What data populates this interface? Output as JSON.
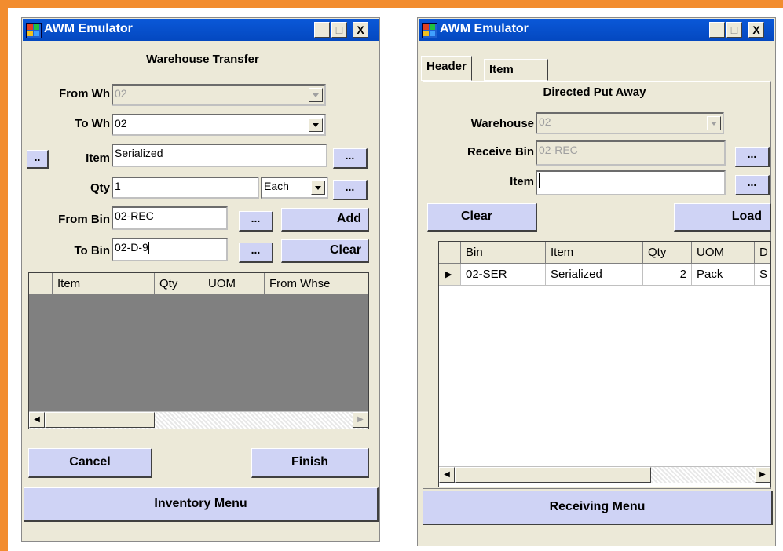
{
  "left_window": {
    "title": "AWM Emulator",
    "window_buttons": {
      "minimize": "_",
      "maximize": "□",
      "close": "X"
    },
    "form_title": "Warehouse Transfer",
    "from_wh": {
      "label": "From Wh",
      "value": "02"
    },
    "to_wh": {
      "label": "To Wh",
      "value": "02"
    },
    "item": {
      "small_button": "..",
      "label": "Item",
      "value": "Serialized",
      "lookup": "..."
    },
    "qty": {
      "label": "Qty",
      "value": "1",
      "uom": "Each",
      "lookup": "..."
    },
    "from_bin": {
      "label": "From Bin",
      "value": "02-REC",
      "lookup": "...",
      "action": "Add"
    },
    "to_bin": {
      "label": "To Bin",
      "value": "02-D-9",
      "lookup": "...",
      "action": "Clear"
    },
    "grid": {
      "columns": [
        "Item",
        "Qty",
        "UOM",
        "From Whse"
      ]
    },
    "cancel": "Cancel",
    "finish": "Finish",
    "menu": "Inventory Menu"
  },
  "right_window": {
    "title": "AWM Emulator",
    "window_buttons": {
      "minimize": "_",
      "maximize": "□",
      "close": "X"
    },
    "tabs": [
      "Header",
      "Item"
    ],
    "form_title": "Directed Put Away",
    "warehouse": {
      "label": "Warehouse",
      "value": "02"
    },
    "receive_bin": {
      "label": "Receive Bin",
      "value": "02-REC",
      "lookup": "..."
    },
    "item": {
      "label": "Item",
      "value": "",
      "lookup": "..."
    },
    "clear": "Clear",
    "load": "Load",
    "grid": {
      "columns": [
        "Bin",
        "Item",
        "Qty",
        "UOM",
        "D"
      ],
      "rows": [
        {
          "bin": "02-SER",
          "item": "Serialized",
          "qty": "2",
          "uom": "Pack",
          "d": "S"
        }
      ]
    },
    "menu": "Receiving Menu"
  },
  "colors": {
    "frame": "#f28c2e",
    "title_bar": "#0a58d8",
    "button": "#cfd3f5",
    "form": "#ece9d8",
    "grid_empty": "#808080"
  }
}
